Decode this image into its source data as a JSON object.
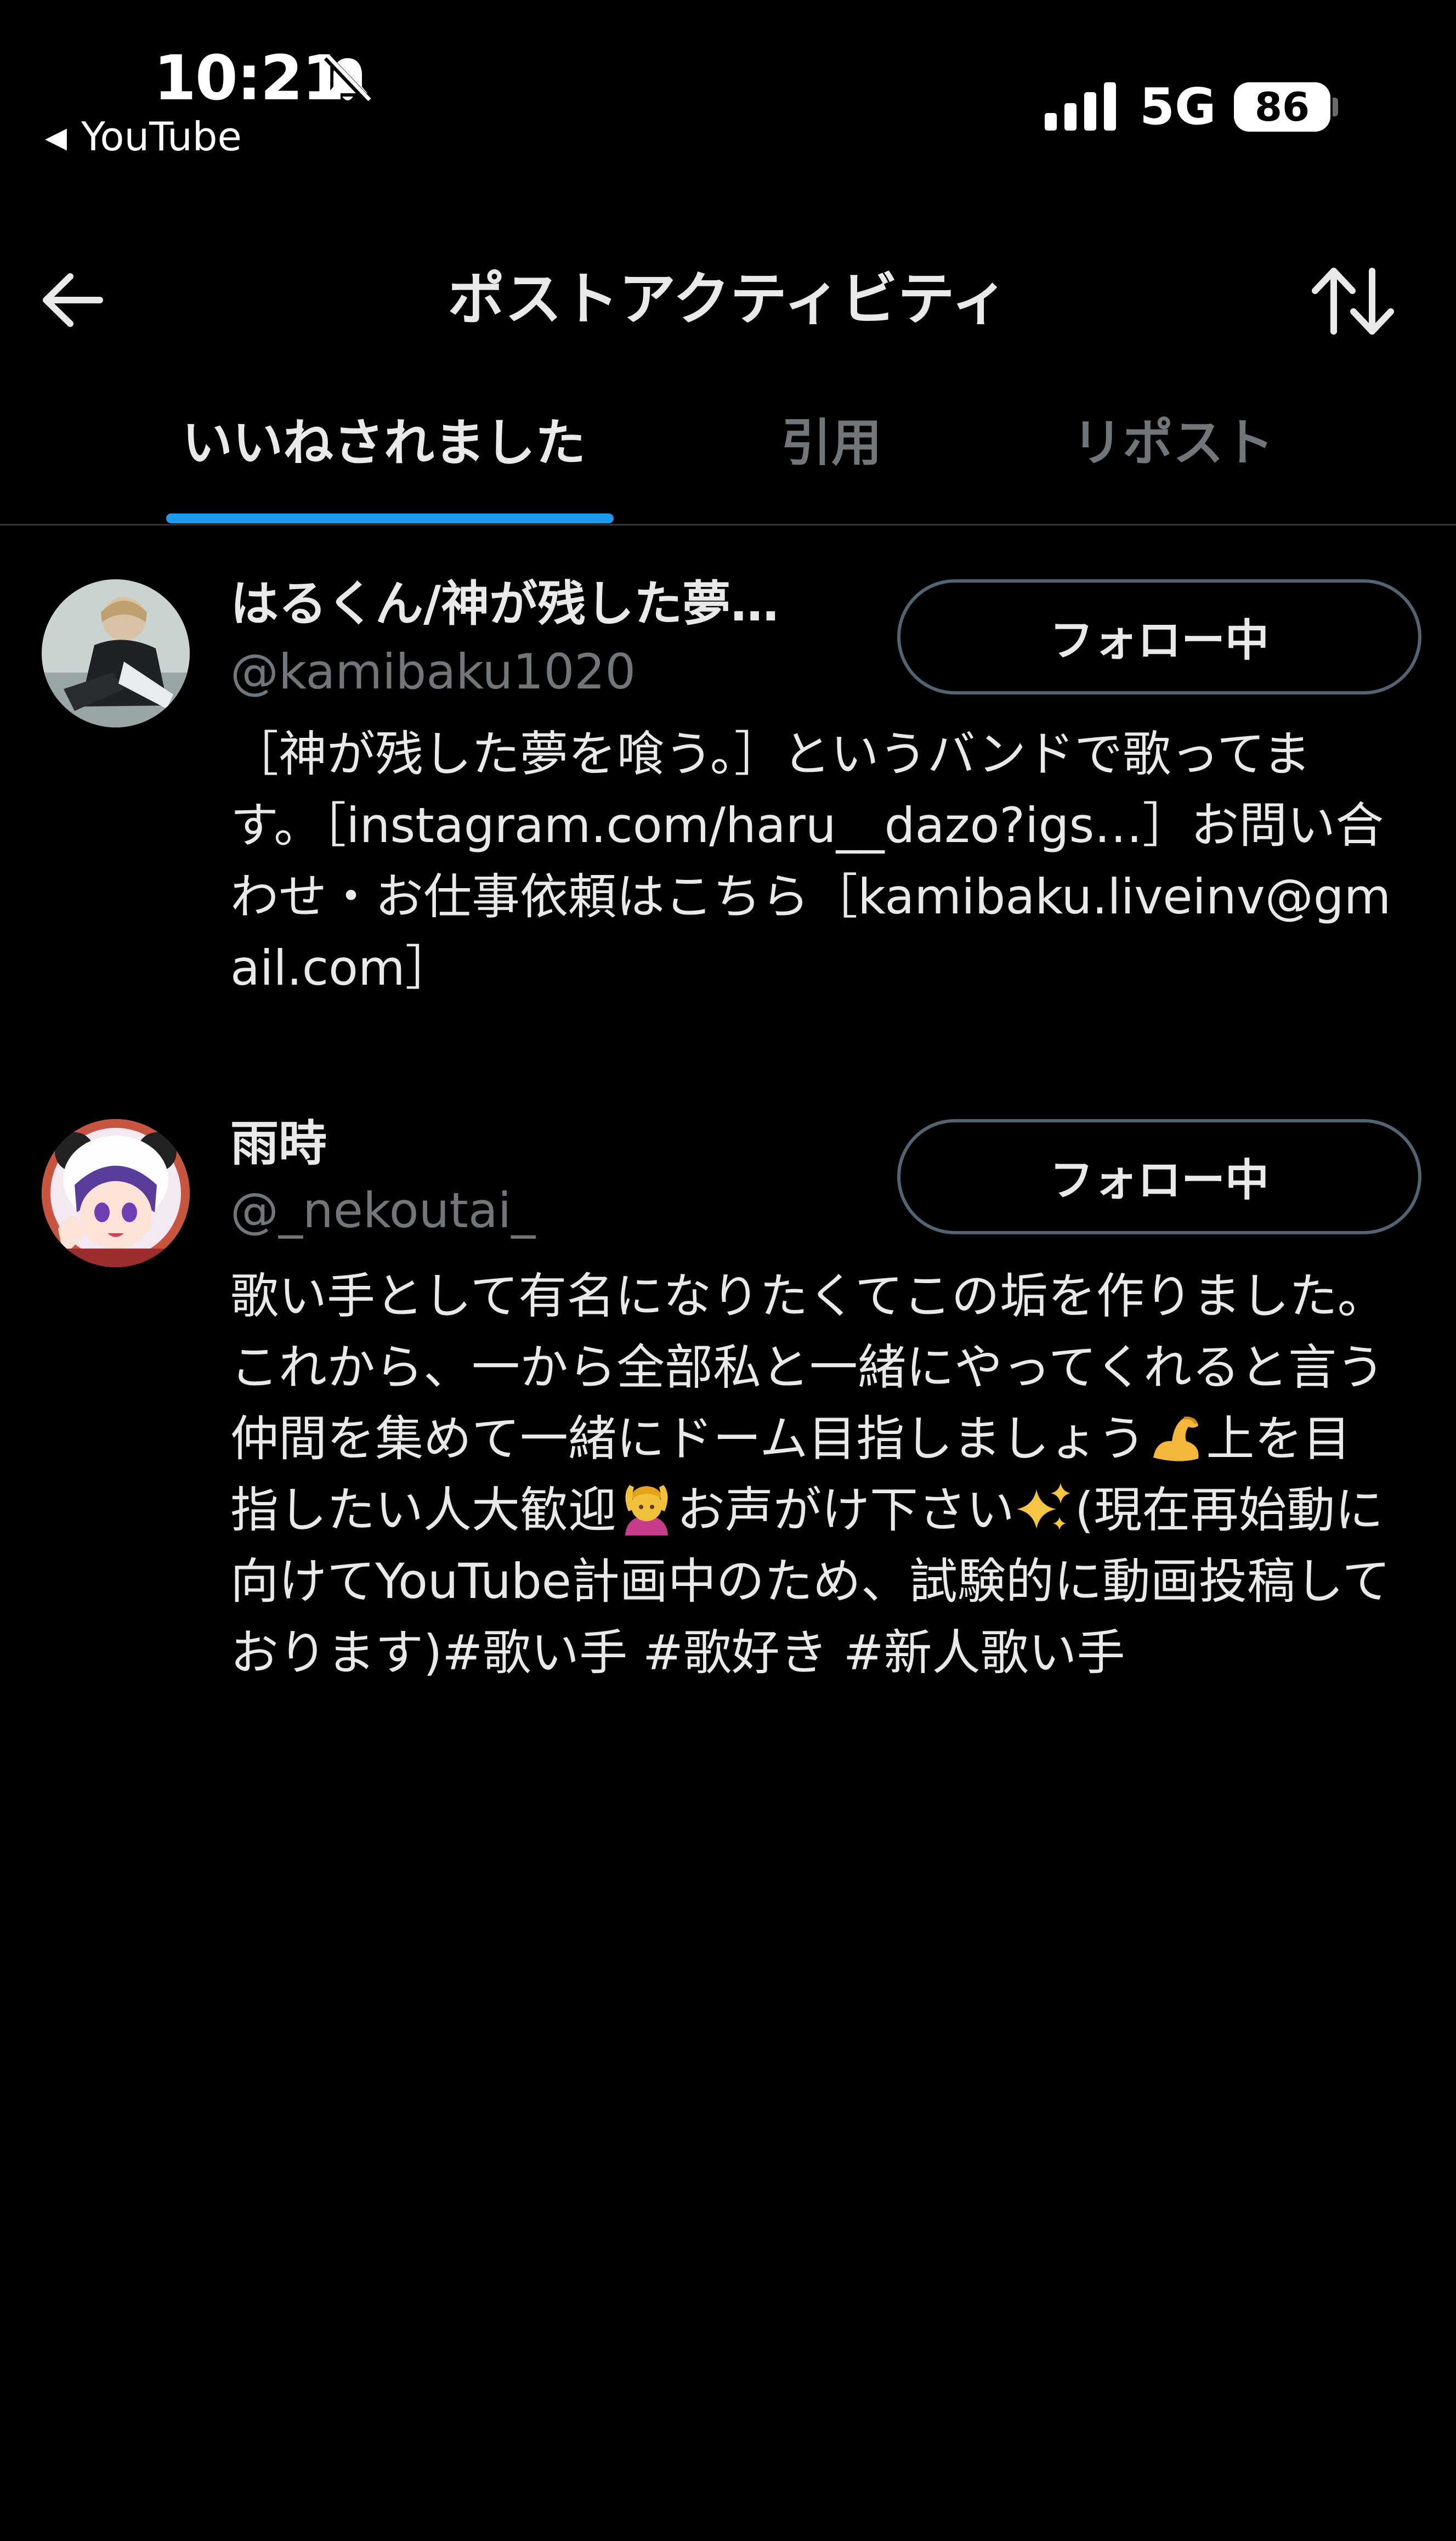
{
  "status_bar": {
    "time": "10:21",
    "back_app": "YouTube",
    "network": "5G",
    "battery": "86"
  },
  "header": {
    "title": "ポストアクティビティ"
  },
  "tabs": [
    {
      "label": "いいねされました",
      "active": true
    },
    {
      "label": "引用",
      "active": false
    },
    {
      "label": "リポスト",
      "active": false
    }
  ],
  "users": [
    {
      "display_name": "はるくん/神が残した夢…",
      "handle": "@kamibaku1020",
      "follow_label": "フォロー中",
      "bio": "［神が残した夢を喰う。］というバンドで歌ってます。［instagram.com/haru__dazo?igs…］お問い合わせ・お仕事依頼はこちら［kamibaku.liveinv@gmail.com］"
    },
    {
      "display_name": "雨時",
      "handle": "@_nekoutai_",
      "follow_label": "フォロー中",
      "bio_part1": "歌い手として有名になりたくてこの垢を作りました。これから、一から全部私と一緒にやってくれると言う仲間を集めて一緒にドーム目指しましょう",
      "bio_part2": "上を目指したい人大歓迎",
      "bio_part3": "お声がけ下さい",
      "bio_part4": "(現在再始動に向けてYouTube計画中のため、試験的に動画投稿しております)#歌い手 #歌好き #新人歌い手"
    }
  ],
  "colors": {
    "background": "#000000",
    "accent": "#1d9bf0",
    "secondary_text": "#71767b"
  },
  "icons": [
    "bell-slash-icon",
    "signal-icon",
    "back-arrow-icon",
    "sort-icon",
    "flexed-biceps-emoji",
    "person-raising-hand-emoji",
    "sparkles-emoji"
  ]
}
